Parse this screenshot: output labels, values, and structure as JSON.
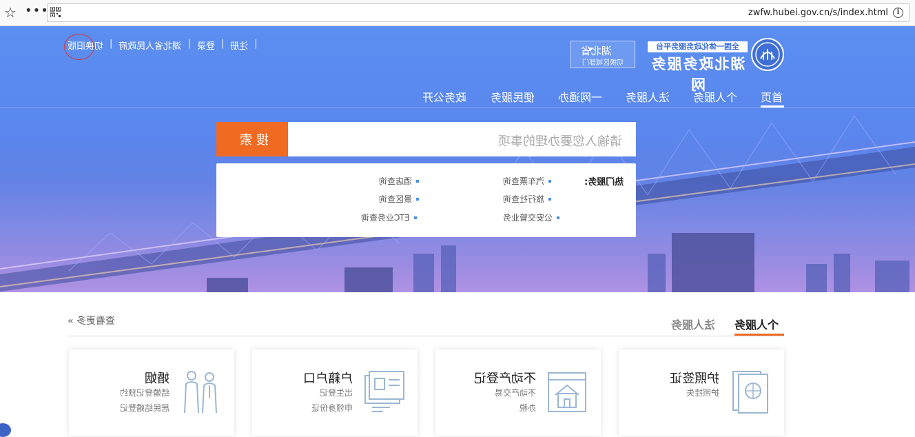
{
  "browser": {
    "url": "zwfw.hubei.gov.cn/s/index.html",
    "info_icon": "info-icon",
    "more_label": "•••",
    "star_icon": "star-icon"
  },
  "header": {
    "links": [
      "注册",
      "登录",
      "湖北省人民政府",
      "切换旧版"
    ],
    "separator": "|",
    "logo_tag": "全国一体化政务服务平台",
    "logo_title": "湖北政务服务网",
    "region": {
      "name": "湖北省",
      "switch_label": "切换区域部门"
    }
  },
  "nav": {
    "items": [
      "首页",
      "个人服务",
      "法人服务",
      "一网通办",
      "便民服务",
      "政务公开"
    ]
  },
  "search": {
    "button_label": "搜索",
    "placeholder": "请输入您要办理的事项"
  },
  "hot": {
    "label": "热门服务:",
    "items": [
      "汽车票查询",
      "酒店查询",
      "旅行社查询",
      "景区查询",
      "公安交管业务",
      "ETC业务查询"
    ]
  },
  "services": {
    "tabs": [
      "个人服务",
      "法人服务"
    ],
    "more_label": "查看更多 »",
    "cards": [
      {
        "title": "护照签证",
        "lines": [
          "护照挂失"
        ],
        "icon": "passport-icon"
      },
      {
        "title": "不动产登记",
        "lines": [
          "不动产交易",
          "办税"
        ],
        "icon": "house-icon"
      },
      {
        "title": "户籍户口",
        "lines": [
          "出生登记",
          "申领身份证"
        ],
        "icon": "id-card-icon"
      },
      {
        "title": "婚姻",
        "lines": [
          "结婚登记预约",
          "居民结婚登记"
        ],
        "icon": "wedding-couple-icon"
      }
    ]
  },
  "colors": {
    "accent": "#f06a22",
    "hero_blue": "#5b8ef0",
    "icon_blue": "#9bb7d4",
    "register_circle": "#dd3333"
  }
}
